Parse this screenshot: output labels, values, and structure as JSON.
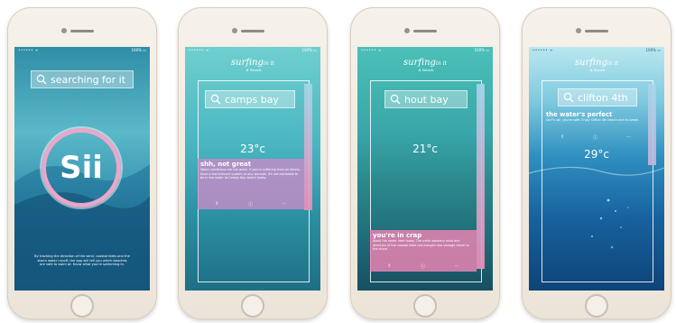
{
  "status": {
    "carrier": "•••••• ᯤ",
    "battery": "100% ▭"
  },
  "screens": [
    {
      "search_text": "searching for it",
      "badge_text": "Sii",
      "info": "By tracking the direction of the wind, coastal tides and the storm water runoff, the app will tell you which beaches are safe to swim at. Know what you're swimming in."
    },
    {
      "logo": "surfing",
      "logo_suffix": "in it",
      "logo_sub": "# Beach",
      "search_text": "camps bay",
      "temp": "23°c",
      "card_title": "shh, not great",
      "card_body": "Water conditions are not great. If you're suffering from an illness, have a low immune system or any wounds, it's not advisable to be in the water at Camps Bay beach today."
    },
    {
      "logo": "surfing",
      "logo_suffix": "in it",
      "logo_sub": "# Beach",
      "search_text": "hout bay",
      "temp": "21°c",
      "card_title": "you're in crap",
      "card_body": "Avoid the water here today. The north-westerly wind and direction of the coastal tides has brought raw sewage closer to the shore."
    },
    {
      "logo": "surfing",
      "logo_suffix": "in it",
      "logo_sub": "# Beach",
      "search_text": "clifton 4th",
      "card_title": "the water's perfect",
      "card_body": "Surf's up!, you're safe. Enjoy Clifton 4th beach and its break.",
      "temp": "29°c"
    }
  ],
  "colors": {
    "bar_top": "#a6d6ea",
    "bar_bottom": "#ee8fb9",
    "card_pink": "#d48cc0"
  }
}
